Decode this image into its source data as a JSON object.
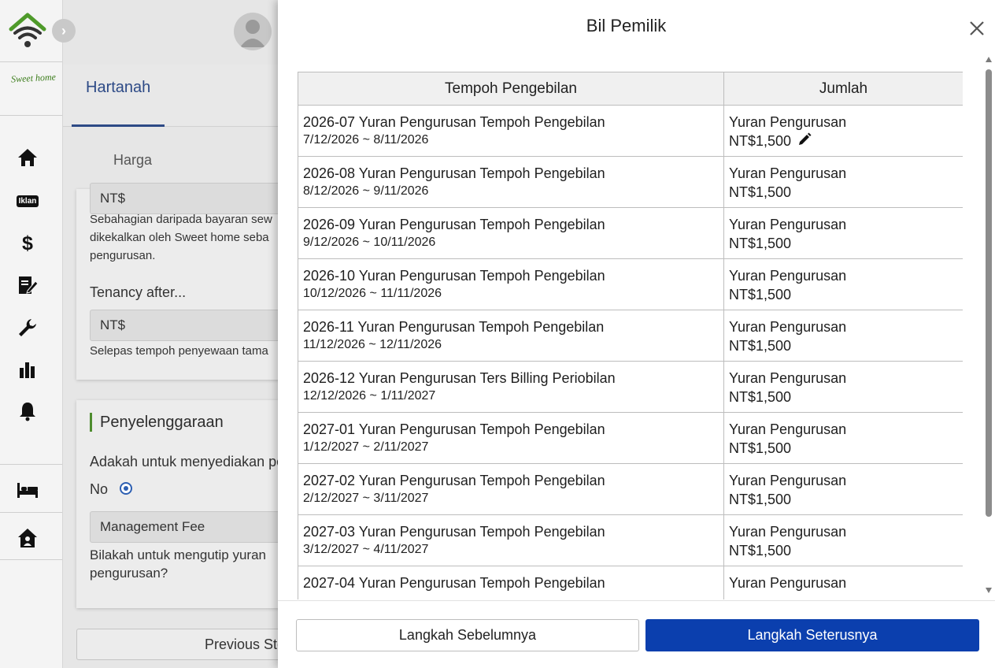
{
  "sidebar": {
    "brand_text": "Sweet home",
    "ads_badge": "Iklan",
    "icons": [
      "wifi-home-logo-icon",
      "home-icon",
      "ads-badge",
      "dollar-icon",
      "contract-edit-icon",
      "wrench-icon",
      "bar-chart-icon",
      "bell-icon",
      "bed-icon",
      "house-user-icon"
    ]
  },
  "background_page": {
    "nav_expand_icon": "chevron-right-icon",
    "tab_active": "Hartanah",
    "sub_tab": "Harga",
    "card1": {
      "field1_value": "NT$",
      "help1": "Sebahagian daripada bayaran sew dikekalkan oleh Sweet home seba pengurusan.",
      "label2": "Tenancy after...",
      "field2_value": "NT$",
      "help2": "Selepas tempoh penyewaan tama"
    },
    "card2": {
      "title": "Penyelenggaraan",
      "question": "Adakah untuk menyediakan pe",
      "radio_label": "No",
      "select_value": "Management Fee",
      "help": "Bilakah untuk mengutip yuran pengurusan?"
    },
    "prev_button": "Previous Ste"
  },
  "modal": {
    "title": "Bil Pemilik",
    "columns": [
      "Tempoh Pengebilan",
      "Jumlah"
    ],
    "rows": [
      {
        "period": "2026-07 Yuran Pengurusan Tempoh Pengebilan",
        "dates": "7/12/2026 ~ 8/11/2026",
        "type": "Yuran Pengurusan",
        "amount": "NT$1,500"
      },
      {
        "period": "2026-08 Yuran Pengurusan Tempoh Pengebilan",
        "dates": "8/12/2026 ~ 9/11/2026",
        "type": "Yuran Pengurusan",
        "amount": "NT$1,500"
      },
      {
        "period": "2026-09 Yuran Pengurusan Tempoh Pengebilan",
        "dates": "9/12/2026 ~ 10/11/2026",
        "type": "Yuran Pengurusan",
        "amount": "NT$1,500"
      },
      {
        "period": "2026-10 Yuran Pengurusan Tempoh Pengebilan",
        "dates": "10/12/2026 ~ 11/11/2026",
        "type": "Yuran Pengurusan",
        "amount": "NT$1,500"
      },
      {
        "period": "2026-11 Yuran Pengurusan Tempoh Pengebilan",
        "dates": "11/12/2026 ~ 12/11/2026",
        "type": "Yuran Pengurusan",
        "amount": "NT$1,500"
      },
      {
        "period": "2026-12 Yuran Pengurusan Ters Billing Periobilan",
        "dates": "12/12/2026 ~ 1/11/2027",
        "type": "Yuran Pengurusan",
        "amount": "NT$1,500"
      },
      {
        "period": "2027-01 Yuran Pengurusan Tempoh Pengebilan",
        "dates": "1/12/2027 ~ 2/11/2027",
        "type": "Yuran Pengurusan",
        "amount": "NT$1,500"
      },
      {
        "period": "2027-02 Yuran Pengurusan Tempoh Pengebilan",
        "dates": "2/12/2027 ~ 3/11/2027",
        "type": "Yuran Pengurusan",
        "amount": "NT$1,500"
      },
      {
        "period": "2027-03 Yuran Pengurusan Tempoh Pengebilan",
        "dates": "3/12/2027 ~ 4/11/2027",
        "type": "Yuran Pengurusan",
        "amount": "NT$1,500"
      },
      {
        "period": "2027-04 Yuran Pengurusan Tempoh Pengebilan",
        "dates": "",
        "type": "Yuran Pengurusan",
        "amount": ""
      }
    ],
    "buttons": {
      "previous": "Langkah Sebelumnya",
      "next": "Langkah Seterusnya"
    },
    "colors": {
      "primary": "#0b3fae",
      "accent_green": "#4e8c2e"
    }
  }
}
